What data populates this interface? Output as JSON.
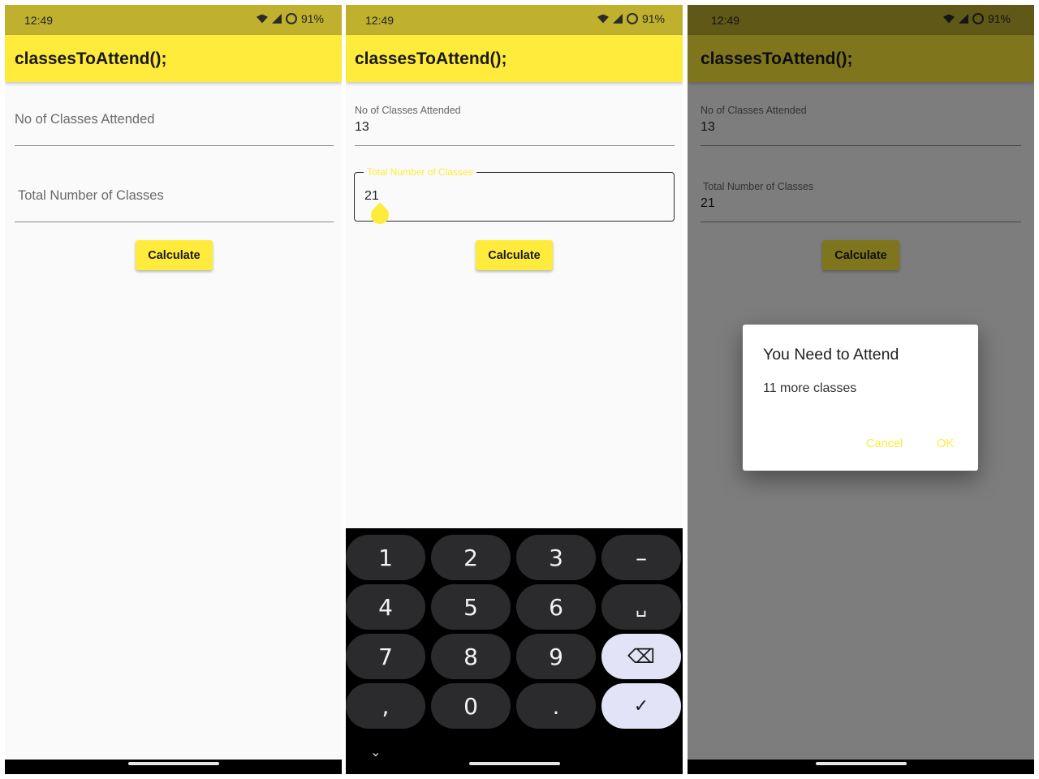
{
  "colors": {
    "accent": "#ffeb3b",
    "status_bar": "#bfb02e",
    "keyboard_special": "#e3e3f7"
  },
  "status": {
    "time": "12:49",
    "battery": "91%"
  },
  "app": {
    "title": "classesToAttend();"
  },
  "fields": {
    "attended_label": "No of Classes Attended",
    "total_label": "Total Number of Classes"
  },
  "values": {
    "attended": "13",
    "total": "21"
  },
  "calculate_label": "Calculate",
  "keyboard": {
    "keys": [
      "1",
      "2",
      "3",
      "–",
      "4",
      "5",
      "6",
      "␣",
      "7",
      "8",
      "9",
      "⌫",
      ",",
      "0",
      ".",
      "✓"
    ],
    "collapse_icon": "⌄"
  },
  "dialog": {
    "title": "You Need to Attend",
    "message": "11 more classes",
    "cancel": "Cancel",
    "ok": "OK"
  }
}
